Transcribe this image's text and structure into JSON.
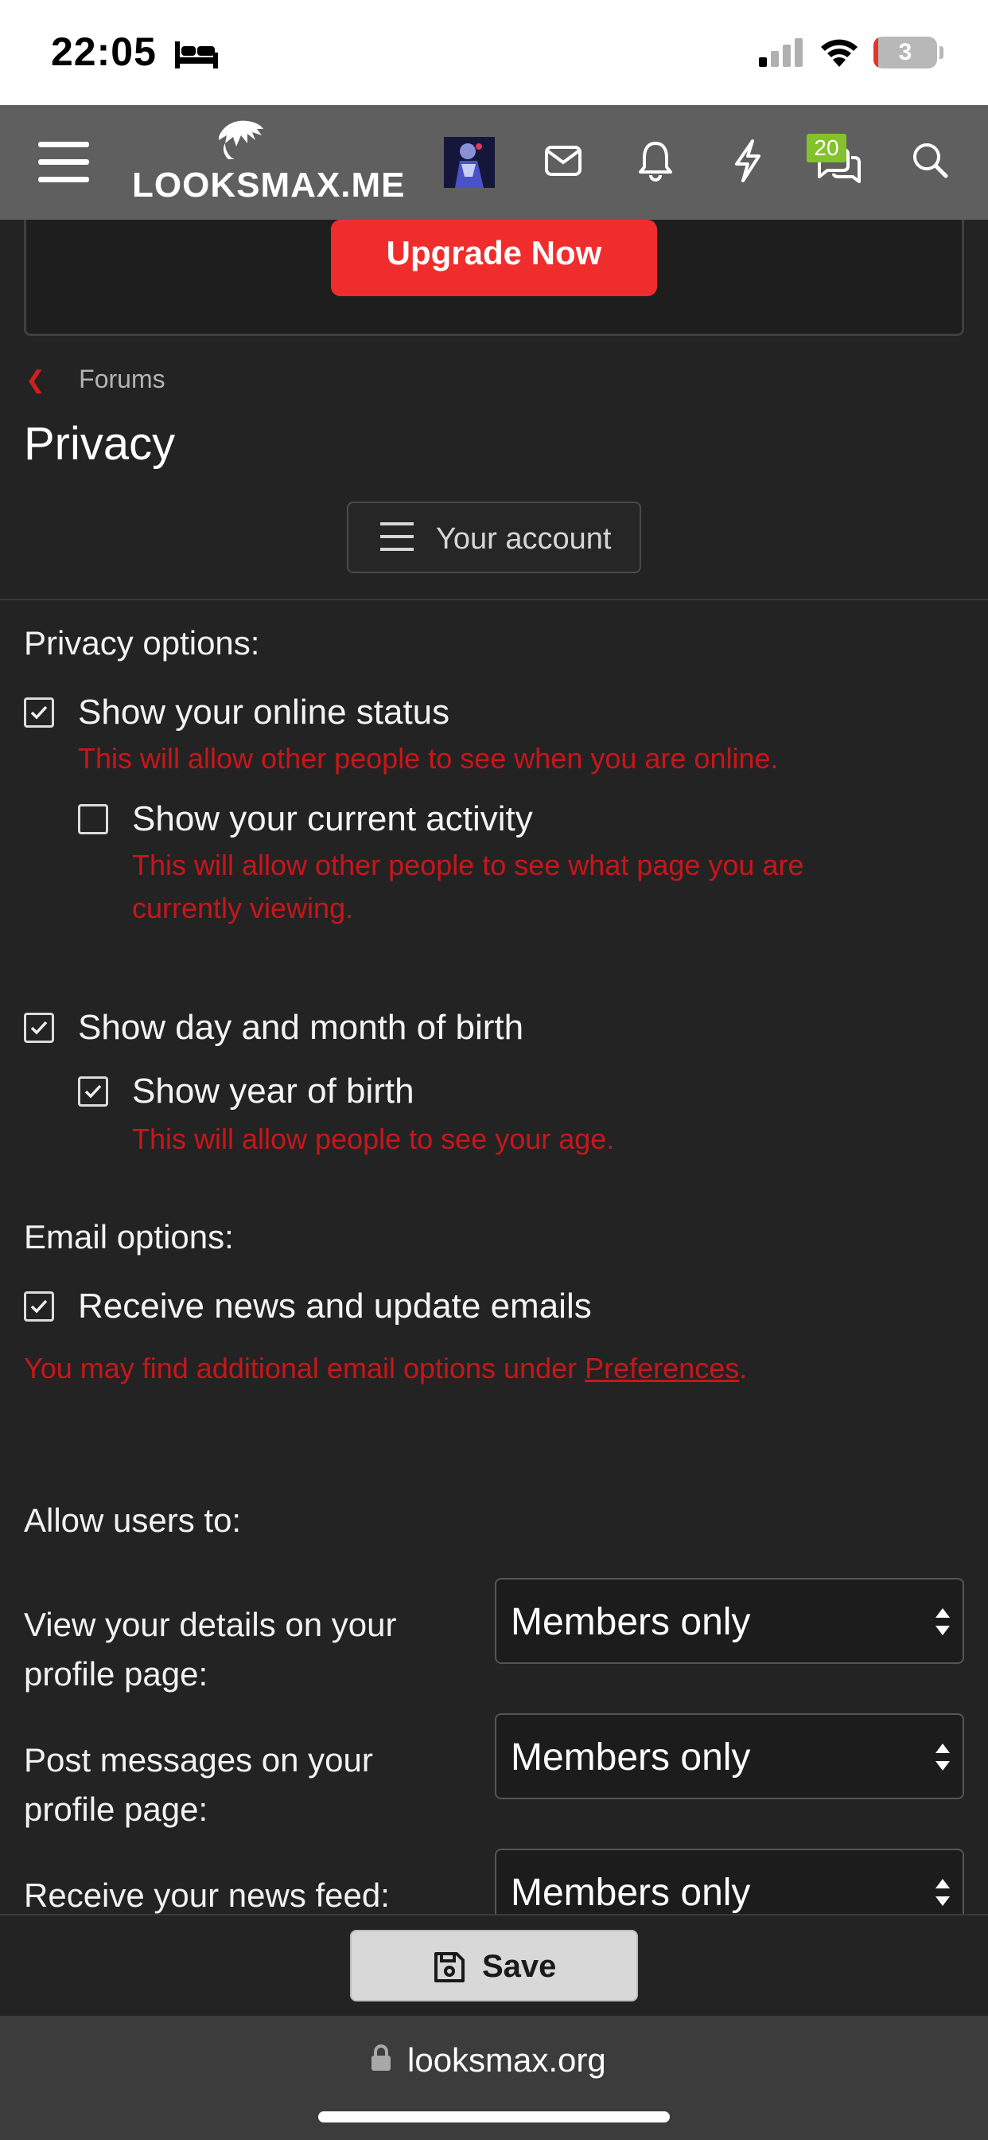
{
  "status_bar": {
    "time": "22:05",
    "battery": "3"
  },
  "header": {
    "logo": "LOOKSMAX.ME",
    "conversations_badge": "20"
  },
  "promo": {
    "button_label": "Upgrade Now"
  },
  "breadcrumb": {
    "label": "Forums"
  },
  "page": {
    "title": "Privacy",
    "account_button": "Your account"
  },
  "privacy": {
    "section_label": "Privacy options:",
    "online_status": {
      "label": "Show your online status",
      "checked": true,
      "hint": "This will allow other people to see when you are online."
    },
    "current_activity": {
      "label": "Show your current activity",
      "checked": false,
      "hint_line1": "This will allow other people to see what page you are",
      "hint_line2": "currently viewing."
    },
    "dob": {
      "label": "Show day and month of birth",
      "checked": true
    },
    "year_of_birth": {
      "label": "Show year of birth",
      "checked": true,
      "hint": "This will allow people to see your age."
    }
  },
  "email": {
    "section_label": "Email options:",
    "news": {
      "label": "Receive news and update emails",
      "checked": true
    },
    "hint_prefix": "You may find additional email options under ",
    "hint_link": "Preferences",
    "hint_suffix": "."
  },
  "allow": {
    "section_label": "Allow users to:",
    "fields": [
      {
        "label_line1": "View your details on your",
        "label_line2": "profile page:",
        "value": "Members only"
      },
      {
        "label_line1": "Post messages on your",
        "label_line2": "profile page:",
        "value": "Members only"
      },
      {
        "label_line1": "Receive your news feed:",
        "label_line2": "",
        "value": "Members only"
      }
    ]
  },
  "actions": {
    "save_label": "Save"
  },
  "browser": {
    "url": "looksmax.org"
  },
  "colors": {
    "accent_red": "#f02d2d",
    "hint_red": "#c8161a",
    "badge_green": "#83c22a",
    "background": "#232324",
    "header": "#5f5f60"
  }
}
